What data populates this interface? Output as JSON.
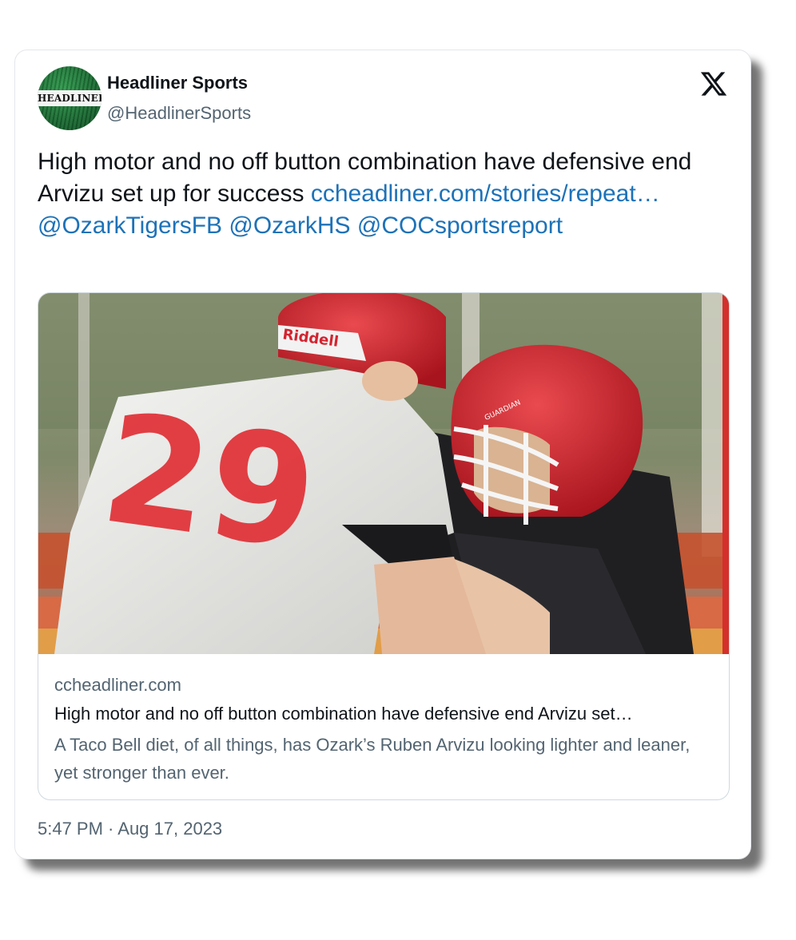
{
  "tweet": {
    "avatar_text": "HEADLINER",
    "author_name": "Headliner Sports",
    "author_handle": "@HeadlinerSports",
    "text": "High motor and no off button combination have defensive end Arvizu set up for success",
    "link_text": "ccheadliner.com/stories/repeat…",
    "mentions": [
      "@OzarkTigersFB",
      "@OzarkHS",
      "@COCsportsreport"
    ],
    "timestamp": "5:47 PM · Aug 17, 2023"
  },
  "link_card": {
    "domain": "ccheadliner.com",
    "title": "High motor and no off button combination have defensive end Arvizu set…",
    "description": "A Taco Bell diet, of all things, has Ozark’s Ruben Arvizu looking lighter and leaner, yet stronger than ever."
  },
  "photo": {
    "helmet_brand_1": "Riddell",
    "helmet_brand_2": "GUARDIAN",
    "jersey_number": "29"
  },
  "icons": {
    "platform": "x-logo-icon"
  },
  "colors": {
    "link": "#1d72b8",
    "text": "#0f1419",
    "secondary": "#536471",
    "helmet_red": "#d4232f"
  }
}
